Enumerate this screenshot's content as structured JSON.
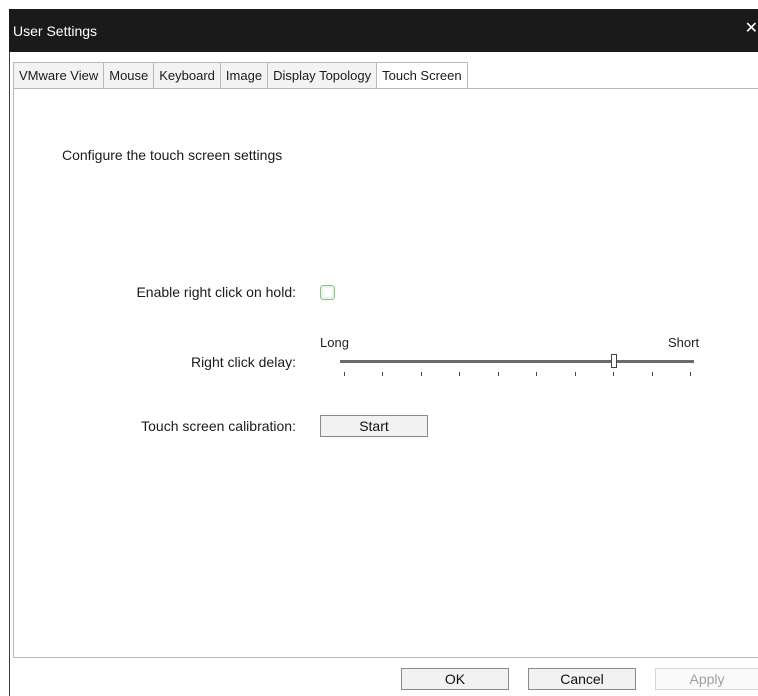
{
  "window": {
    "title": "User Settings",
    "close_glyph": "✕"
  },
  "tabs": [
    {
      "label": "VMware View",
      "active": false
    },
    {
      "label": "Mouse",
      "active": false
    },
    {
      "label": "Keyboard",
      "active": false
    },
    {
      "label": "Image",
      "active": false
    },
    {
      "label": "Display Topology",
      "active": false
    },
    {
      "label": "Touch Screen",
      "active": true
    }
  ],
  "touch": {
    "heading": "Configure the touch screen settings",
    "right_click_label": "Enable right click on hold:",
    "right_click_checked": false,
    "delay_label": "Right click delay:",
    "delay_min_label": "Long",
    "delay_max_label": "Short",
    "delay_ticks": 10,
    "delay_value": 0.78,
    "calibration_label": "Touch screen calibration:",
    "calibration_button": "Start"
  },
  "footer": {
    "ok": "OK",
    "cancel": "Cancel",
    "apply": "Apply"
  }
}
